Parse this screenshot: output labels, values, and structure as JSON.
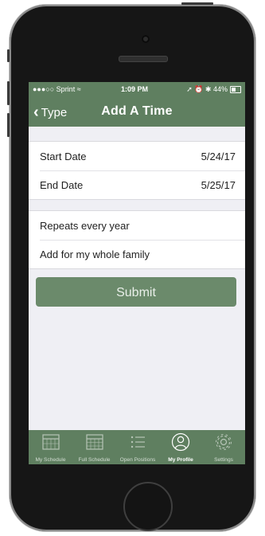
{
  "status_bar": {
    "carrier": "●●●○○ Sprint ≈",
    "time": "1:09 PM",
    "indicators": "➚ ⏰ ✱ 44%"
  },
  "nav": {
    "back_label": "Type",
    "title": "Add A Time"
  },
  "date_rows": [
    {
      "label": "Start Date",
      "value": "5/24/17"
    },
    {
      "label": "End Date",
      "value": "5/25/17"
    }
  ],
  "options": [
    {
      "label": "Repeats every year"
    },
    {
      "label": "Add for my whole family"
    }
  ],
  "submit_label": "Submit",
  "tabs": [
    {
      "label": "My Schedule",
      "icon": "calendar-icon",
      "active": false
    },
    {
      "label": "Full Schedule",
      "icon": "calendar-grid-icon",
      "active": false
    },
    {
      "label": "Open Positions",
      "icon": "list-icon",
      "active": false
    },
    {
      "label": "My Profile",
      "icon": "profile-icon",
      "active": true
    },
    {
      "label": "Settings",
      "icon": "gear-icon",
      "active": false
    }
  ],
  "colors": {
    "brand_green": "#5f7f60",
    "button_green": "#6b8a6b",
    "screen_background": "#efeff4"
  }
}
